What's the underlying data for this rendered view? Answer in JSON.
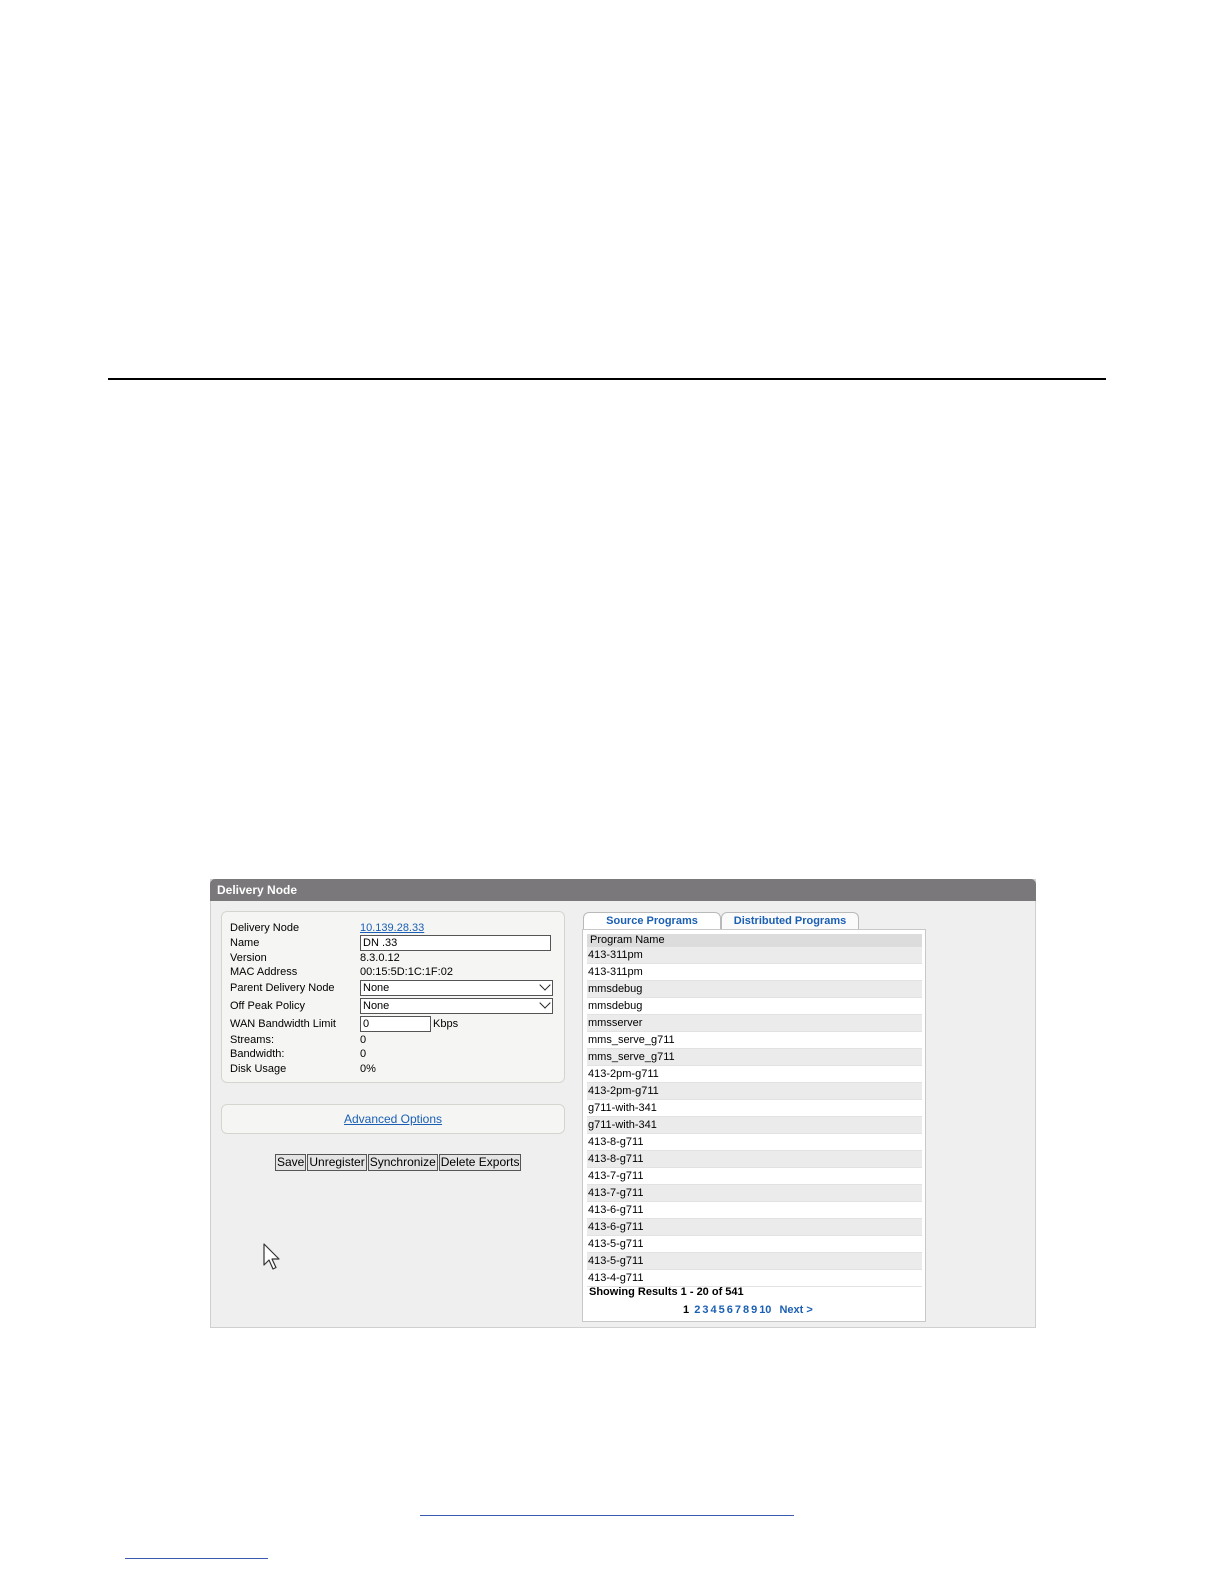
{
  "window": {
    "title": "Delivery Node"
  },
  "properties": {
    "delivery_node_label": "Delivery Node",
    "delivery_node_value": "10.139.28.33",
    "name_label": "Name",
    "name_value": "DN .33",
    "version_label": "Version",
    "version_value": "8.3.0.12",
    "mac_label": "MAC Address",
    "mac_value": "00:15:5D:1C:1F:02",
    "parent_label": "Parent Delivery Node",
    "parent_value": "None",
    "offpeak_label": "Off Peak Policy",
    "offpeak_value": "None",
    "wan_label": "WAN Bandwidth Limit",
    "wan_value": "0",
    "wan_unit": "Kbps",
    "streams_label": "Streams:",
    "streams_value": "0",
    "bandwidth_label": "Bandwidth:",
    "bandwidth_value": "0",
    "disk_label": "Disk Usage",
    "disk_value": "0%"
  },
  "advanced": {
    "label": "Advanced Options"
  },
  "buttons": {
    "save": "Save",
    "unregister": "Unregister",
    "synchronize": "Synchronize",
    "delete_exports": "Delete Exports"
  },
  "tabs": {
    "source": "Source Programs",
    "distributed": "Distributed Programs"
  },
  "table": {
    "header": "Program Name",
    "rows": [
      "413-311pm",
      "413-311pm",
      "mmsdebug",
      "mmsdebug",
      "mmsserver",
      "mms_serve_g711",
      "mms_serve_g711",
      "413-2pm-g711",
      "413-2pm-g711",
      "g711-with-341",
      "g711-with-341",
      "413-8-g711",
      "413-8-g711",
      "413-7-g711",
      "413-7-g711",
      "413-6-g711",
      "413-6-g711",
      "413-5-g711",
      "413-5-g711",
      "413-4-g711"
    ]
  },
  "results": {
    "showing": "Showing Results 1 - 20 of 541"
  },
  "pager": {
    "current": "1",
    "pages": [
      "2",
      "3",
      "4",
      "5",
      "6",
      "7",
      "8",
      "9",
      "10"
    ],
    "next": "Next >"
  }
}
